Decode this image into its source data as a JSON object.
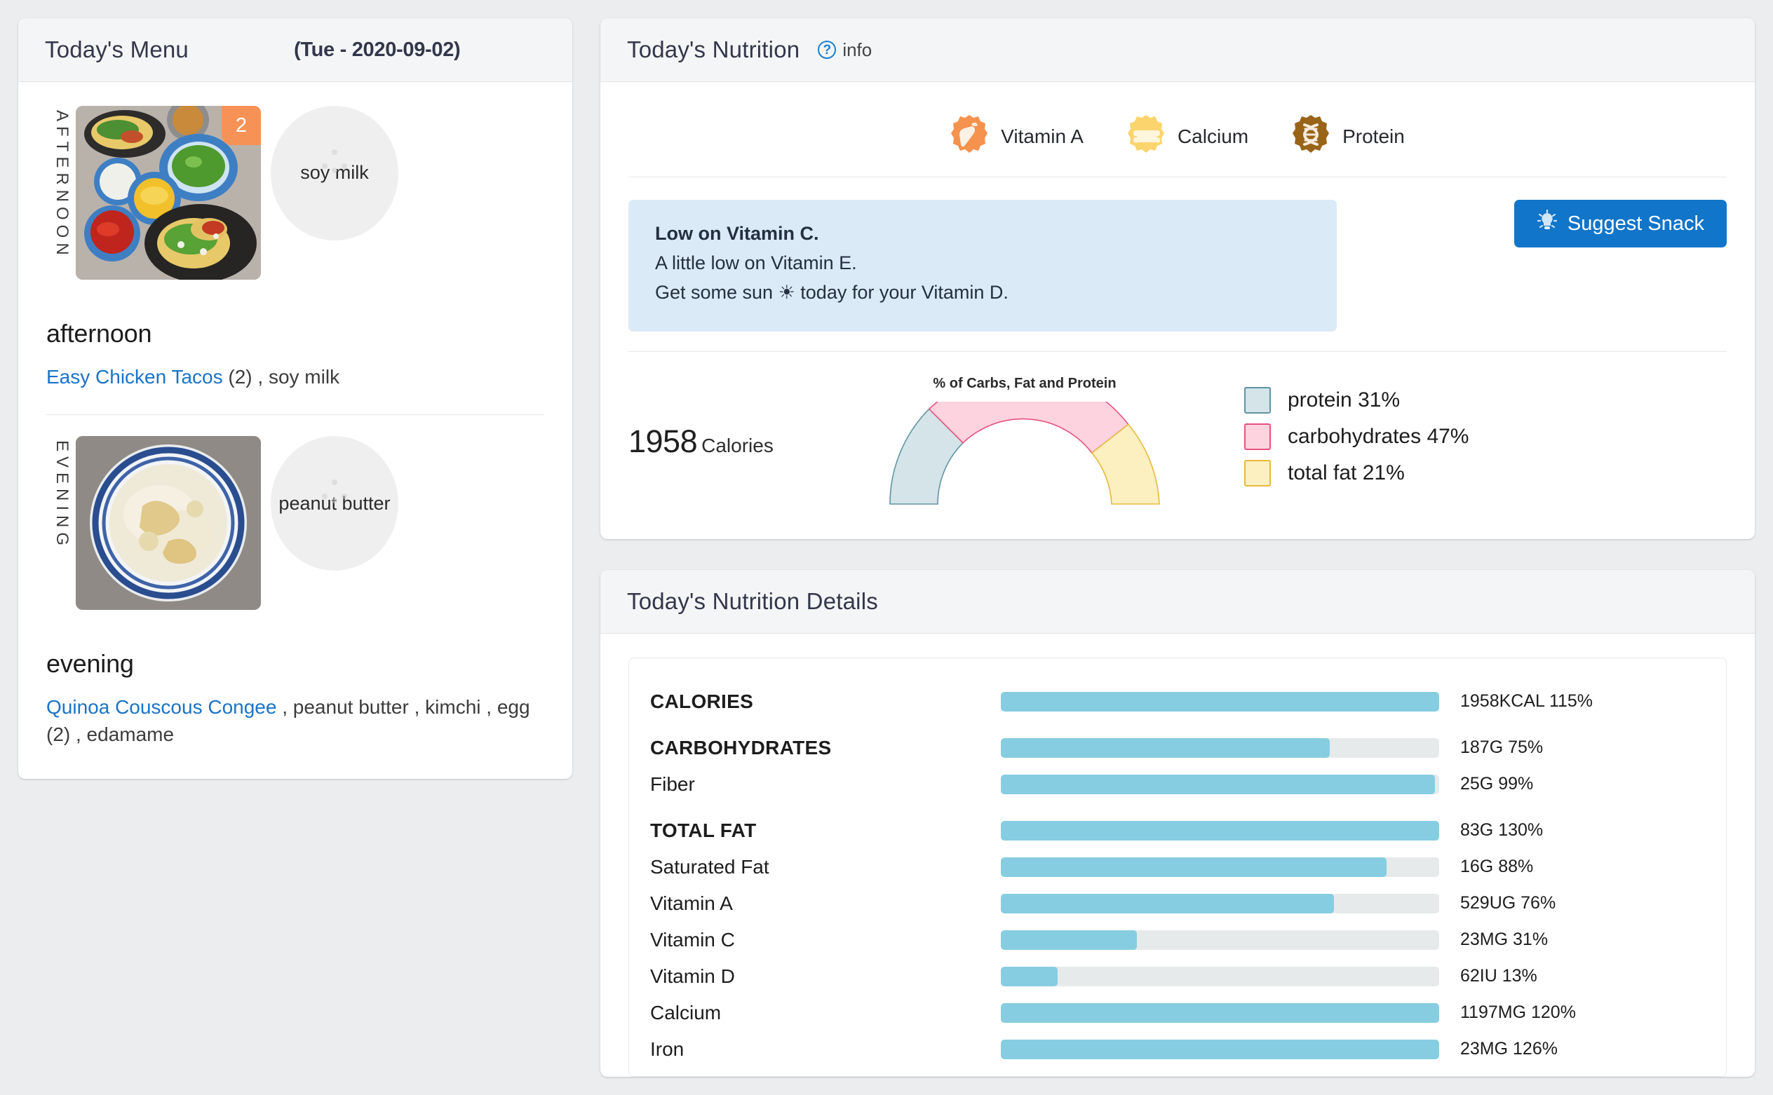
{
  "menu": {
    "title": "Today's Menu",
    "date": "(Tue - 2020-09-02)",
    "meals": [
      {
        "vertical_label": "AFTERNOON",
        "photo_badge_qty": "2",
        "side_pill_label": "soy milk",
        "name": "afternoon",
        "link_text": "Easy Chicken Tacos",
        "rest_text": " (2) , soy milk",
        "photo_alt": "chicken-tacos-photo"
      },
      {
        "vertical_label": "EVENING",
        "photo_badge_qty": "",
        "side_pill_label": "peanut butter",
        "name": "evening",
        "link_text": "Quinoa Couscous Congee",
        "rest_text": " , peanut butter , kimchi , egg (2) , edamame",
        "photo_alt": "congee-photo"
      }
    ]
  },
  "nutrition": {
    "title": "Today's Nutrition",
    "info_label": "info",
    "badges": [
      {
        "label": "Vitamin A",
        "icon": "carrot-icon",
        "color": "#f4924e"
      },
      {
        "label": "Calcium",
        "icon": "bone-icon",
        "color": "#fbd46d"
      },
      {
        "label": "Protein",
        "icon": "dna-icon",
        "color": "#9a6418"
      }
    ],
    "advice": [
      {
        "text": "Low on Vitamin C.",
        "bold": true
      },
      {
        "text": "A little low on Vitamin E.",
        "bold": false
      },
      {
        "text": "Get some sun ☀ today for your Vitamin D.",
        "bold": false
      }
    ],
    "suggest_button": "Suggest  Snack",
    "calories_value": "1958",
    "calories_unit": "Calories"
  },
  "chart_data": {
    "type": "pie",
    "title": "% of Carbs, Fat and Protein",
    "labels": [
      "protein",
      "carbohydrates",
      "total fat"
    ],
    "values": [
      31,
      47,
      21
    ],
    "legend_entries": [
      "protein 31%",
      "carbohydrates 47%",
      "total fat 21%"
    ],
    "colors": [
      "#d4e4e8",
      "#fcd3de",
      "#fcefc0"
    ],
    "stroke_colors": [
      "#5f95a2",
      "#e8527e",
      "#e8b93c"
    ],
    "legend_position": "right",
    "semicircle": true
  },
  "details": {
    "title": "Today's Nutrition Details",
    "rows": [
      {
        "label": "CALORIES",
        "major": true,
        "pct": 115,
        "value": "1958KCAL 115%"
      },
      {
        "label": "CARBOHYDRATES",
        "major": true,
        "pct": 75,
        "value": "187G 75%"
      },
      {
        "label": "Fiber",
        "major": false,
        "pct": 99,
        "value": "25G 99%"
      },
      {
        "label": "TOTAL FAT",
        "major": true,
        "pct": 130,
        "value": "83G 130%"
      },
      {
        "label": "Saturated Fat",
        "major": false,
        "pct": 88,
        "value": "16G 88%"
      },
      {
        "label": "Vitamin A",
        "major": false,
        "pct": 76,
        "value": "529UG 76%"
      },
      {
        "label": "Vitamin C",
        "major": false,
        "pct": 31,
        "value": "23MG 31%"
      },
      {
        "label": "Vitamin D",
        "major": false,
        "pct": 13,
        "value": "62IU 13%"
      },
      {
        "label": "Calcium",
        "major": false,
        "pct": 120,
        "value": "1197MG 120%"
      },
      {
        "label": "Iron",
        "major": false,
        "pct": 126,
        "value": "23MG 126%"
      }
    ]
  },
  "colors": {
    "accent_blue": "#1175c9",
    "bar_fill": "#86cde1",
    "advice_bg": "#dbeaf7",
    "badge_orange": "#f79257"
  }
}
